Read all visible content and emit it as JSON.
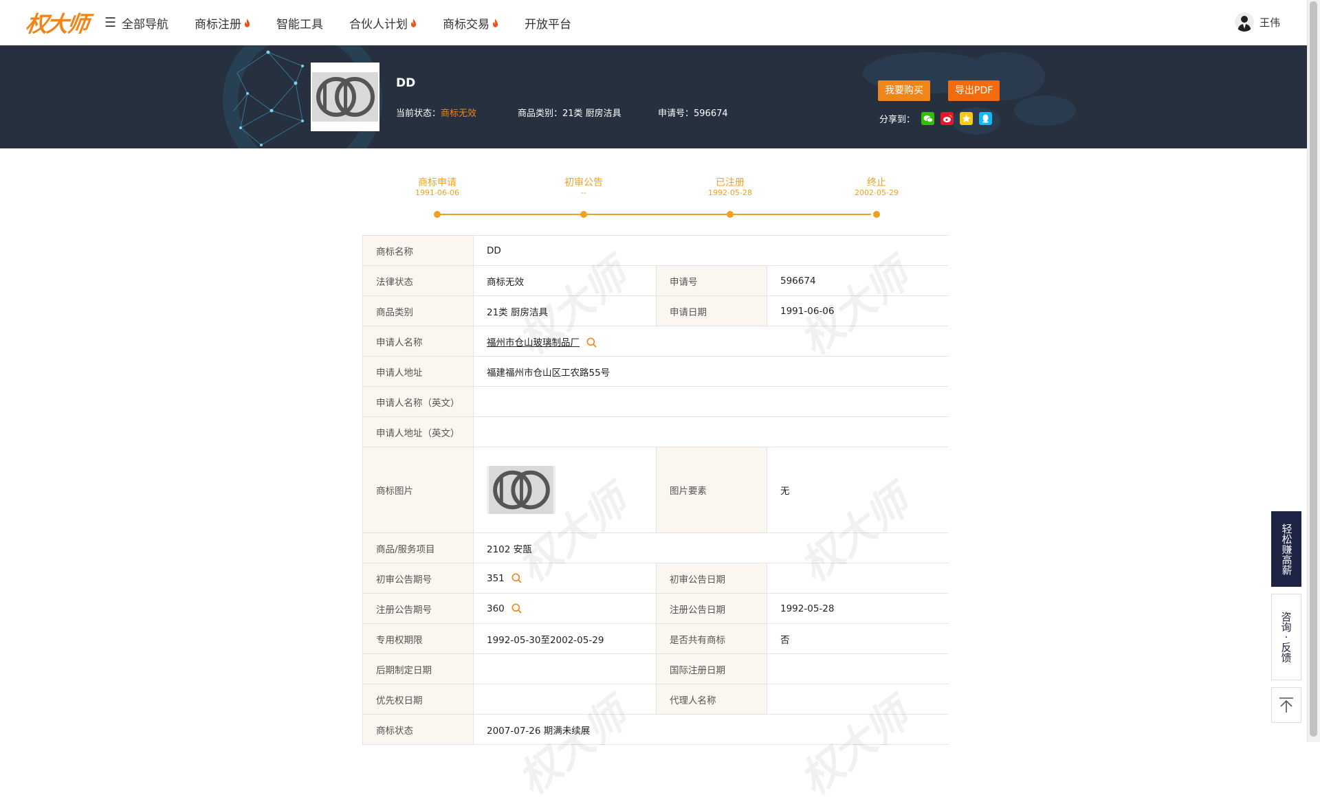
{
  "nav": {
    "logo": "权大师",
    "items": [
      {
        "label": "全部导航",
        "hot": false,
        "menu": true
      },
      {
        "label": "商标注册",
        "hot": true
      },
      {
        "label": "智能工具",
        "hot": false
      },
      {
        "label": "合伙人计划",
        "hot": true
      },
      {
        "label": "商标交易",
        "hot": true
      },
      {
        "label": "开放平台",
        "hot": false
      }
    ],
    "user_name": "王伟"
  },
  "banner": {
    "title": "DD",
    "status_label": "当前状态：",
    "status_value": "商标无效",
    "category": "商品类别：21类 厨房洁具",
    "app_no": "申请号：596674",
    "buy_button": "我要购买",
    "pdf_button": "导出PDF",
    "share_label": "分享到："
  },
  "timeline": [
    {
      "label": "商标申请",
      "date": "1991-06-06"
    },
    {
      "label": "初审公告",
      "date": "--"
    },
    {
      "label": "已注册",
      "date": "1992-05-28"
    },
    {
      "label": "终止",
      "date": "2002-05-29"
    }
  ],
  "details": {
    "name_k": "商标名称",
    "name_v": "DD",
    "legal_k": "法律状态",
    "legal_v": "商标无效",
    "appno_k": "申请号",
    "appno_v": "596674",
    "cat_k": "商品类别",
    "cat_v": "21类 厨房洁具",
    "appdate_k": "申请日期",
    "appdate_v": "1991-06-06",
    "applicant_k": "申请人名称",
    "applicant_v": "福州市仓山玻璃制品厂",
    "addr_k": "申请人地址",
    "addr_v": "福建福州市仓山区工农路55号",
    "applicant_en_k": "申请人名称（英文）",
    "applicant_en_v": "",
    "addr_en_k": "申请人地址（英文）",
    "addr_en_v": "",
    "img_k": "商标图片",
    "img_elem_k": "图片要素",
    "img_elem_v": "无",
    "goods_k": "商品/服务项目",
    "goods_v": "2102 安瓿",
    "prelim_no_k": "初审公告期号",
    "prelim_no_v": "351",
    "prelim_date_k": "初审公告日期",
    "prelim_date_v": "",
    "reg_no_k": "注册公告期号",
    "reg_no_v": "360",
    "reg_date_k": "注册公告日期",
    "reg_date_v": "1992-05-28",
    "term_k": "专用权期限",
    "term_v": "1992-05-30至2002-05-29",
    "shared_k": "是否共有商标",
    "shared_v": "否",
    "later_k": "后期制定日期",
    "later_v": "",
    "intl_k": "国际注册日期",
    "intl_v": "",
    "priority_k": "优先权日期",
    "priority_v": "",
    "agent_k": "代理人名称",
    "agent_v": "",
    "tmstatus_k": "商标状态",
    "tmstatus_v": "2007-07-26 期满未续展"
  },
  "watermark": "权大师",
  "side": {
    "earn": "轻松赚高薪",
    "consult": "咨询 · 反馈"
  },
  "colors": {
    "accent": "#f08519",
    "banner_bg": "#26303f",
    "timeline": "#f0a020",
    "key_cell_bg": "#fbf7f0",
    "side_dark": "#1d2446"
  }
}
